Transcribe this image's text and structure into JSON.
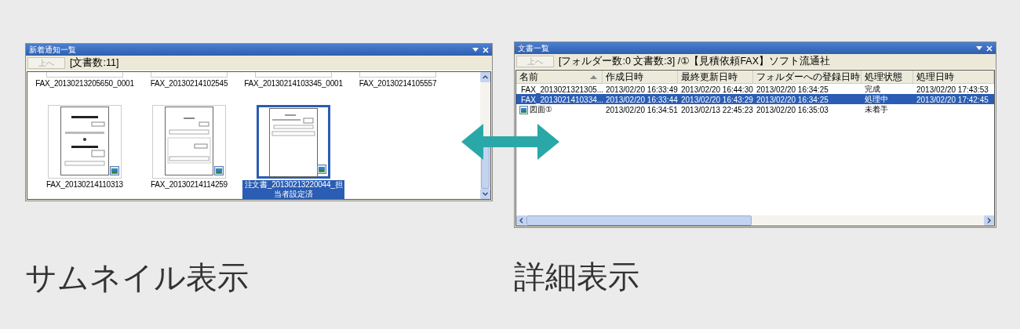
{
  "thumbnail_panel": {
    "title": "新着通知一覧",
    "up_button": {
      "label": "上へ",
      "disabled": true
    },
    "status": "[文書数:11]",
    "items": [
      {
        "label": "FAX_20130213205650_0001",
        "kind": "cut",
        "selected": false
      },
      {
        "label": "FAX_20130214102545",
        "kind": "cut",
        "selected": false
      },
      {
        "label": "FAX_20130214103345_0001",
        "kind": "cut",
        "selected": false
      },
      {
        "label": "FAX_20130214105557",
        "kind": "cut",
        "selected": false
      },
      {
        "label": "FAX_20130214110313",
        "kind": "thumb",
        "selected": false
      },
      {
        "label": "FAX_20130214114259",
        "kind": "thumb",
        "selected": false
      },
      {
        "label": "注文書_20130213220044_担当者設定済",
        "kind": "thumb",
        "selected": true
      }
    ]
  },
  "detail_panel": {
    "title": "文書一覧",
    "up_button": {
      "label": "上へ",
      "disabled": true
    },
    "status": "[フォルダー数:0 文書数:3] /①【見積依頼FAX】ソフト流通社",
    "columns": [
      "名前",
      "作成日時",
      "最終更新日時",
      "フォルダーへの登録日時",
      "処理状態",
      "処理日時"
    ],
    "rows": [
      {
        "cells": [
          "FAX_2013021321305...",
          "2013/02/20 16:33:49",
          "2013/02/20 16:44:30",
          "2013/02/20 16:34:25",
          "完成",
          "2013/02/20 17:43:53"
        ],
        "selected": false
      },
      {
        "cells": [
          "FAX_2013021410334...",
          "2013/02/20 16:33:44",
          "2013/02/20 16:43:29",
          "2013/02/20 16:34:25",
          "処理中",
          "2013/02/20 17:42:45"
        ],
        "selected": true
      },
      {
        "cells": [
          "図面①",
          "2013/02/20 16:34:51",
          "2013/02/13 22:45:23",
          "2013/02/20 16:35:03",
          "未着手"
        ],
        "selected": false
      }
    ]
  },
  "captions": [
    "サムネイル表示",
    "詳細表示"
  ]
}
